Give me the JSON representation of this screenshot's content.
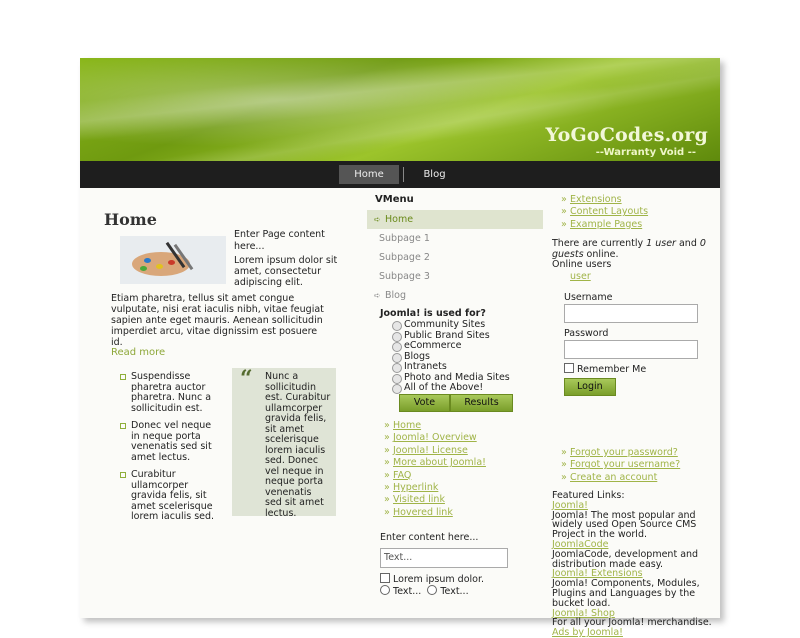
{
  "site": {
    "name": "YoGoCodes.org",
    "slogan": "--Warranty Void --"
  },
  "topnav": [
    "Home",
    "Blog"
  ],
  "main": {
    "title": "Home",
    "intro": "Enter Page content here...",
    "lorem": "Lorem ipsum dolor sit amet, consectetur adipiscing elit.",
    "etiam": "Etiam pharetra, tellus sit amet congue vulputate, nisi erat iaculis nibh, vitae feugiat sapien ante eget mauris. Aenean sollicitudin imperdiet arcu, vitae dignissim est posuere id.",
    "readmore": "Read more",
    "bullets": [
      "Suspendisse pharetra auctor pharetra. Nunc a sollicitudin est.",
      "Donec vel neque in neque porta venenatis sed sit amet lectus.",
      "Curabitur ullamcorper gravida felis, sit amet scelerisque lorem iaculis sed."
    ],
    "quote": "Nunc a sollicitudin est. Curabitur ullamcorper gravida felis, sit amet scelerisque lorem iaculis sed. Donec vel neque in neque porta venenatis sed sit amet lectus."
  },
  "vmenu": {
    "title": "VMenu",
    "items": [
      "Home",
      "Subpage 1",
      "Subpage 2",
      "Subpage 3",
      "Blog"
    ]
  },
  "poll": {
    "title": "Joomla! is used for?",
    "options": [
      "Community Sites",
      "Public Brand Sites",
      "eCommerce",
      "Blogs",
      "Intranets",
      "Photo and Media Sites",
      "All of the Above!"
    ],
    "vote": "Vote",
    "results": "Results"
  },
  "links": [
    "Home",
    "Joomla! Overview",
    "Joomla! License",
    "More about Joomla!",
    "FAQ",
    "Hyperlink",
    "Visited link",
    "Hovered link"
  ],
  "form": {
    "enter_label": "Enter content here...",
    "text_placeholder": "Text...",
    "checkbox_label": "Lorem ipsum dolor.",
    "radio1": "Text...",
    "radio2": "Text..."
  },
  "right": {
    "links": [
      "Extensions",
      "Content Layouts",
      "Example Pages"
    ],
    "online_pre": "There are currently ",
    "online_users": "1 user",
    "online_mid": " and ",
    "online_guests": "0 guests",
    "online_post": " online.",
    "online_users_label": "Online users",
    "user_link": "user",
    "username_label": "Username",
    "password_label": "Password",
    "remember": "Remember Me",
    "login_button": "Login",
    "account_links": [
      "Forgot your password?",
      "Forgot your username?",
      "Create an account"
    ],
    "featured_title": "Featured Links:",
    "featured": [
      {
        "link": "Joomla!",
        "desc": "Joomla! The most popular and widely used Open Source CMS Project in the world."
      },
      {
        "link": "JoomlaCode",
        "desc": "JoomlaCode, development and distribution made easy."
      },
      {
        "link": "Joomla! Extensions",
        "desc": "Joomla! Components, Modules, Plugins and Languages by the bucket load."
      },
      {
        "link": "Joomla! Shop",
        "desc": "For all your Joomla! merchandise."
      },
      {
        "link": "Ads by Joomla!",
        "desc": ""
      }
    ]
  },
  "colors": {
    "accent_green": "#8fae3b",
    "link_green": "#a0b448",
    "nav_bg": "#1e1e1e"
  }
}
